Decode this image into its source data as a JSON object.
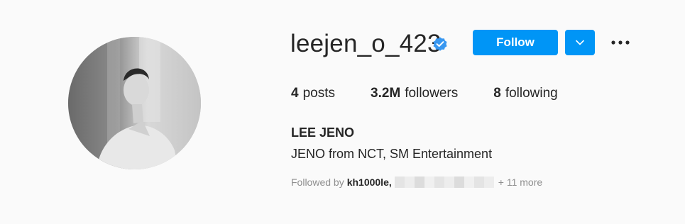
{
  "profile": {
    "username": "leejen_o_423",
    "verified": true,
    "full_name": "LEE JENO",
    "bio": "JENO from NCT, SM Entertainment"
  },
  "actions": {
    "follow_label": "Follow",
    "dropdown_icon": "chevron-down-icon",
    "more_icon": "more-options-icon"
  },
  "stats": {
    "posts_count": "4",
    "posts_label": "posts",
    "followers_count": "3.2M",
    "followers_label": "followers",
    "following_count": "8",
    "following_label": "following"
  },
  "followed_by": {
    "prefix": "Followed by",
    "first_user": "kh1000le,",
    "more": "+ 11 more"
  },
  "colors": {
    "accent": "#0095f6",
    "verified": "#3897f0",
    "background": "#fafafa",
    "text": "#262626",
    "secondary_text": "#8e8e8e"
  }
}
